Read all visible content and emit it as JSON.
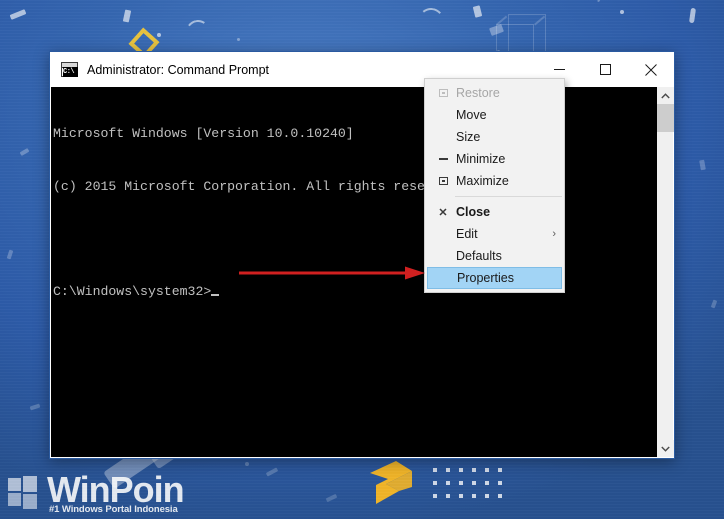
{
  "window": {
    "title": "Administrator: Command Prompt",
    "icon": "cmd-icon",
    "buttons": {
      "minimize": "minimize-icon",
      "maximize": "maximize-icon",
      "close": "close-icon"
    }
  },
  "console": {
    "lines": [
      "Microsoft Windows [Version 10.0.10240]",
      "(c) 2015 Microsoft Corporation. All rights reserved.",
      "",
      "C:\\Windows\\system32>"
    ]
  },
  "scrollbar": {
    "up_arrow": "chevron-up-icon",
    "down_arrow": "chevron-down-icon"
  },
  "context_menu": {
    "items": [
      {
        "label": "Restore",
        "icon": "restore-icon",
        "disabled": true,
        "bold": false,
        "selected": false,
        "submenu": false
      },
      {
        "label": "Move",
        "icon": "",
        "disabled": false,
        "bold": false,
        "selected": false,
        "submenu": false
      },
      {
        "label": "Size",
        "icon": "",
        "disabled": false,
        "bold": false,
        "selected": false,
        "submenu": false
      },
      {
        "label": "Minimize",
        "icon": "minimize-icon",
        "disabled": false,
        "bold": false,
        "selected": false,
        "submenu": false
      },
      {
        "label": "Maximize",
        "icon": "maximize-icon",
        "disabled": false,
        "bold": false,
        "selected": false,
        "submenu": false
      },
      {
        "label": "Close",
        "icon": "close-x-icon",
        "disabled": false,
        "bold": true,
        "selected": false,
        "submenu": false
      },
      {
        "label": "Edit",
        "icon": "",
        "disabled": false,
        "bold": false,
        "selected": false,
        "submenu": true
      },
      {
        "label": "Defaults",
        "icon": "",
        "disabled": false,
        "bold": false,
        "selected": false,
        "submenu": false
      },
      {
        "label": "Properties",
        "icon": "",
        "disabled": false,
        "bold": false,
        "selected": true,
        "submenu": false
      }
    ],
    "separator_after_index": 4,
    "submenu_glyph": "›"
  },
  "annotation": {
    "arrow_color": "#d02020"
  },
  "watermark": {
    "title": "WinPoin",
    "tagline": "#1 Windows Portal Indonesia"
  },
  "colors": {
    "accent_blue": "#2d5ba8",
    "selection_blue": "#a2d4f5",
    "logo_yellow": "#f0b428",
    "console_bg": "#000000",
    "console_fg": "#c0c0c0"
  }
}
